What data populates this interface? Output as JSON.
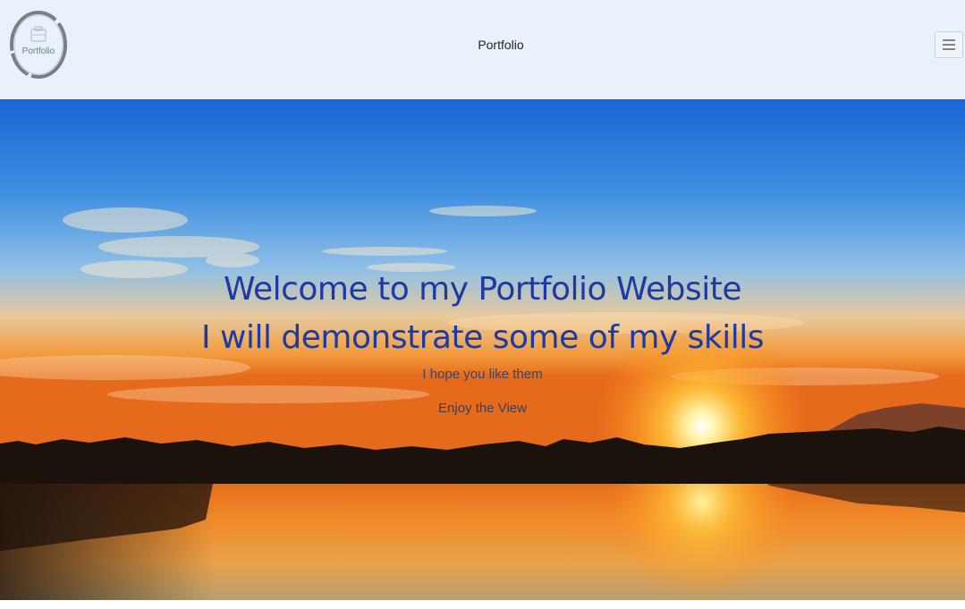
{
  "navbar": {
    "logo_text": "Portfolio",
    "brand": "Portfolio",
    "menu_icon": "hamburger-menu-icon"
  },
  "hero": {
    "background": "sunset-lake-image",
    "title_line1": "Welcome to my Portfolio Website",
    "title_line2": "I will demonstrate some of my skills",
    "subtitle": "I hope you like them",
    "link_text": "Enjoy the View"
  },
  "colors": {
    "navbar_bg": "#e9f2fb",
    "title": "#1b3aa3",
    "subtitle": "#3c4466"
  }
}
